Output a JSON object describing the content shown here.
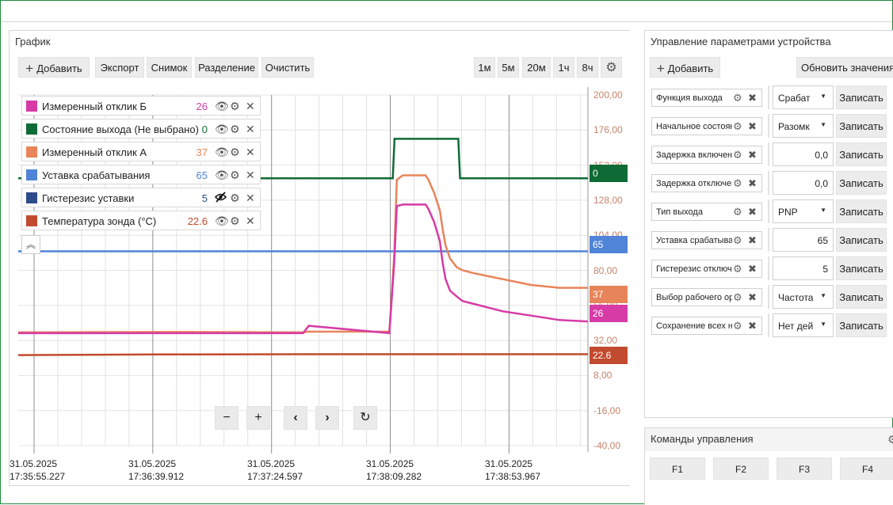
{
  "chart_panel": {
    "title": "График",
    "toolbar": {
      "add": "Добавить",
      "export": "Экспорт",
      "snapshot": "Снимок",
      "split": "Разделение",
      "clear": "Очистить",
      "range_1m": "1м",
      "range_5m": "5м",
      "range_20m": "20м",
      "range_1h": "1ч",
      "range_8h": "8ч"
    },
    "legend": [
      {
        "label": "Измеренный отклик Б",
        "value": "26",
        "color": "#d63ba6",
        "visible": true
      },
      {
        "label": "Состояние выхода (Не выбрано)",
        "value": "0",
        "color": "#0f6b35",
        "visible": true
      },
      {
        "label": "Измеренный отклик А",
        "value": "37",
        "color": "#e8845a",
        "visible": true
      },
      {
        "label": "Уставка срабатывания",
        "value": "65",
        "color": "#4f84d8",
        "visible": true
      },
      {
        "label": "Гистерезис уставки",
        "value": "5",
        "color": "#2f4a8a",
        "visible": false
      },
      {
        "label": "Температура зонда (°C)",
        "value": "22.6",
        "color": "#c24a2e",
        "visible": true
      }
    ],
    "tags": [
      {
        "text": "0",
        "color": "#0f6b35",
        "y": 0
      },
      {
        "text": "65",
        "color": "#4f84d8",
        "y": 65
      },
      {
        "text": "37",
        "color": "#e8845a",
        "y": 37
      },
      {
        "text": "26",
        "color": "#d63ba6",
        "y": 26
      },
      {
        "text": "22.6",
        "color": "#c24a2e",
        "y": 22.6
      }
    ]
  },
  "chart_data": {
    "type": "line",
    "ylim": [
      -40,
      200
    ],
    "yticks": [
      "200,00",
      "176,00",
      "152,00",
      "128,00",
      "104,00",
      "80,00",
      "56,00",
      "32,00",
      "8,00",
      "-16,00",
      "-40,00"
    ],
    "xticks": [
      {
        "date": "31.05.2025",
        "time": "17:35:55.227"
      },
      {
        "date": "31.05.2025",
        "time": "17:36:39.912"
      },
      {
        "date": "31.05.2025",
        "time": "17:37:24.597"
      },
      {
        "date": "31.05.2025",
        "time": "17:38:09.282"
      },
      {
        "date": "31.05.2025",
        "time": "17:38:53.967"
      }
    ],
    "series": [
      {
        "name": "Состояние выхода (Не выбрано)",
        "color": "#0f6b35",
        "x": [
          0,
          0.6575,
          0.6605,
          0.7725,
          0.7755,
          1
        ],
        "y": [
          143,
          143,
          170,
          170,
          143,
          143
        ]
      },
      {
        "name": "Уставка срабатывания",
        "color": "#4f84d8",
        "x": [
          0,
          1
        ],
        "y": [
          93,
          93
        ]
      },
      {
        "name": "Температура зонда (°C)",
        "color": "#c24a2e",
        "x": [
          0,
          0.25,
          0.5,
          0.75,
          1
        ],
        "y": [
          22,
          22.4,
          22.6,
          22.6,
          22.6
        ]
      },
      {
        "name": "Измеренный отклик А",
        "color": "#e8845a",
        "x": [
          0,
          0.3,
          0.5,
          0.51,
          0.6515,
          0.66,
          0.6645,
          0.675,
          0.715,
          0.72,
          0.73,
          0.74,
          0.745,
          0.75,
          0.758,
          0.77,
          0.78,
          0.8,
          0.85,
          0.9,
          0.95,
          1
        ],
        "y": [
          37.5,
          37.8,
          37.5,
          38,
          38,
          90,
          142,
          145,
          145,
          142,
          133,
          121,
          108,
          97,
          88,
          82,
          80,
          78,
          74,
          70,
          68,
          68
        ]
      },
      {
        "name": "Измеренный отклик Б",
        "color": "#d63ba6",
        "x": [
          0,
          0.3,
          0.5,
          0.51,
          0.6515,
          0.66,
          0.6645,
          0.675,
          0.715,
          0.72,
          0.73,
          0.74,
          0.745,
          0.75,
          0.758,
          0.77,
          0.78,
          0.8,
          0.85,
          0.9,
          0.95,
          1
        ],
        "y": [
          37,
          37,
          37,
          42,
          37,
          85,
          124,
          125,
          125,
          122,
          113,
          100,
          85,
          74,
          66,
          62,
          59,
          57,
          52,
          49,
          46,
          45
        ]
      }
    ]
  },
  "params_panel": {
    "title": "Управление параметрами устройства",
    "add": "Добавить",
    "refresh": "Обновить значения",
    "write_label": "Записать",
    "rows": [
      {
        "label": "Функция выхода",
        "value": "Срабат",
        "type": "select"
      },
      {
        "label": "Начальное состояние",
        "value": "Разомк",
        "type": "select"
      },
      {
        "label": "Задержка включения",
        "value": "0,0",
        "type": "number"
      },
      {
        "label": "Задержка отключения",
        "value": "0,0",
        "type": "number"
      },
      {
        "label": "Тип выхода",
        "value": "PNP",
        "type": "select"
      },
      {
        "label": "Уставка срабатывания",
        "value": "65",
        "type": "number"
      },
      {
        "label": "Гистерезис отключения",
        "value": "5",
        "type": "number"
      },
      {
        "label": "Выбор рабочего органа",
        "value": "Частота",
        "type": "select"
      },
      {
        "label": "Сохранение всех настроек",
        "value": "Нет дей",
        "type": "select"
      }
    ]
  },
  "commands_panel": {
    "title": "Команды управления",
    "buttons": [
      "F1",
      "F2",
      "F3",
      "F4"
    ]
  }
}
